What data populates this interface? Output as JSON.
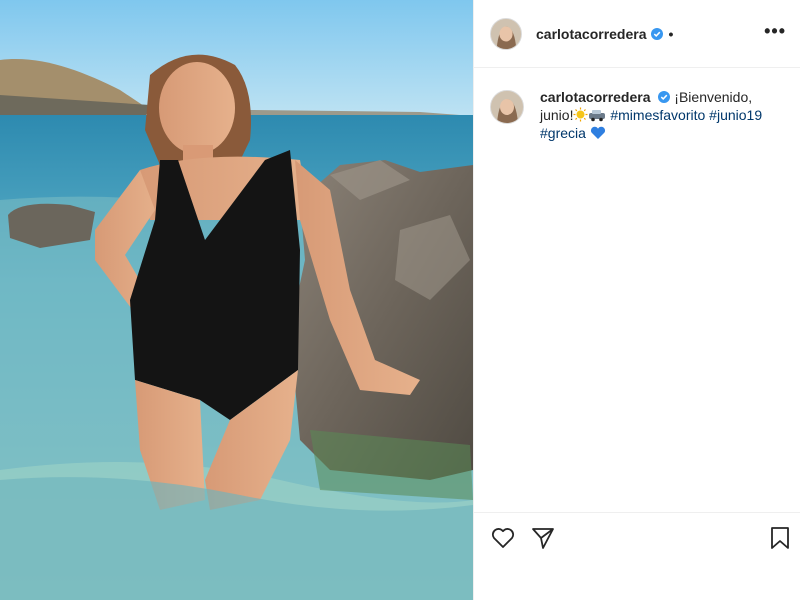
{
  "post": {
    "username": "carlotacorredera",
    "verified": true,
    "separator": "•",
    "more_label": "•••",
    "caption": {
      "text_start": "¡Bienvenido, junio!",
      "emojis": [
        "sun-emoji",
        "car-emoji"
      ],
      "hashtags": [
        "#mimesfavorito",
        "#junio19",
        "#grecia"
      ],
      "trailing_emoji": "blue-heart-emoji"
    },
    "actions": [
      "like",
      "share",
      "save"
    ]
  },
  "colors": {
    "hashtag": "#00376b",
    "verified": "#3897f0",
    "text": "#262626",
    "border": "#efefef"
  }
}
